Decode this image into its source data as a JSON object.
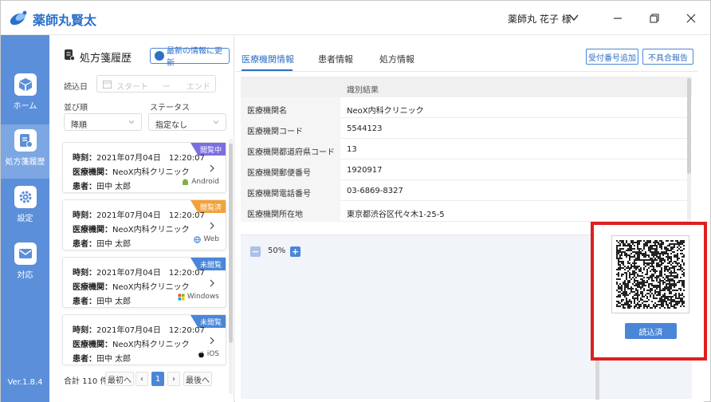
{
  "app": {
    "title": "薬師丸賢太",
    "user": "薬師丸 花子 様"
  },
  "colors": {
    "accent": "#4a86d8",
    "sidebar": "#5b8fd9",
    "highlight": "#e01e1e"
  },
  "sidebar": {
    "items": [
      {
        "label": "ホーム",
        "icon": "cube-icon"
      },
      {
        "label": "処方箋履歴",
        "icon": "document-icon"
      },
      {
        "label": "設定",
        "icon": "gear-icon"
      },
      {
        "label": "対応",
        "icon": "message-icon"
      }
    ],
    "version": "Ver.1.8.4"
  },
  "history": {
    "title": "処方箋履歴",
    "refresh_label": "最新の情報に更新",
    "date_label": "読込日",
    "date_start_placeholder": "スタート",
    "date_sep": "ー",
    "date_end_placeholder": "エンド",
    "sort_label": "並び順",
    "sort_value": "降順",
    "status_label": "ステータス",
    "status_value": "指定なし",
    "time_label": "時刻：",
    "clinic_label": "医療機関：",
    "patient_label": "患者：",
    "cards": [
      {
        "time": "2021年07月04日　12:20:07",
        "clinic": "NeoX内科クリニック",
        "patient": "田中 太郎",
        "status": "閲覧中",
        "status_color": "#7b6fe0",
        "platform": "Android",
        "platform_icon": "android-icon"
      },
      {
        "time": "2021年07月04日　12:20:07",
        "clinic": "NeoX内科クリニック",
        "patient": "田中 太郎",
        "status": "閲覧済",
        "status_color": "#f2a23a",
        "platform": "Web",
        "platform_icon": "globe-icon"
      },
      {
        "time": "2021年07月04日　12:20:07",
        "clinic": "NeoX内科クリニック",
        "patient": "田中 太郎",
        "status": "未閲覧",
        "status_color": "#4a86d8",
        "platform": "Windows",
        "platform_icon": "windows-icon"
      },
      {
        "time": "2021年07月04日　12:20:07",
        "clinic": "NeoX内科クリニック",
        "patient": "田中 太郎",
        "status": "未閲覧",
        "status_color": "#4a86d8",
        "platform": "iOS",
        "platform_icon": "apple-icon"
      }
    ],
    "pager": {
      "total": "合計 110 件",
      "first": "最初へ",
      "prev": "‹",
      "current": "1",
      "next": "›",
      "last": "最後へ"
    }
  },
  "main": {
    "tabs": [
      "医療機関情報",
      "患者情報",
      "処方情報"
    ],
    "buttons": {
      "add_receipt": "受付番号追加",
      "report_issue": "不具合報告"
    },
    "table_header": "識別結果",
    "rows": [
      {
        "label": "医療機関名",
        "value": "NeoX内科クリニック"
      },
      {
        "label": "医療機関コード",
        "value": "5544123"
      },
      {
        "label": "医療機関都道府県コード",
        "value": "13"
      },
      {
        "label": "医療機関郵便番号",
        "value": "1920917"
      },
      {
        "label": "医療機関電話番号",
        "value": "03-6869-8327"
      },
      {
        "label": "医療機関所在地",
        "value": "東京都渋谷区代々木1-25-5"
      }
    ],
    "zoom": "50%",
    "read_button": "読込済"
  }
}
